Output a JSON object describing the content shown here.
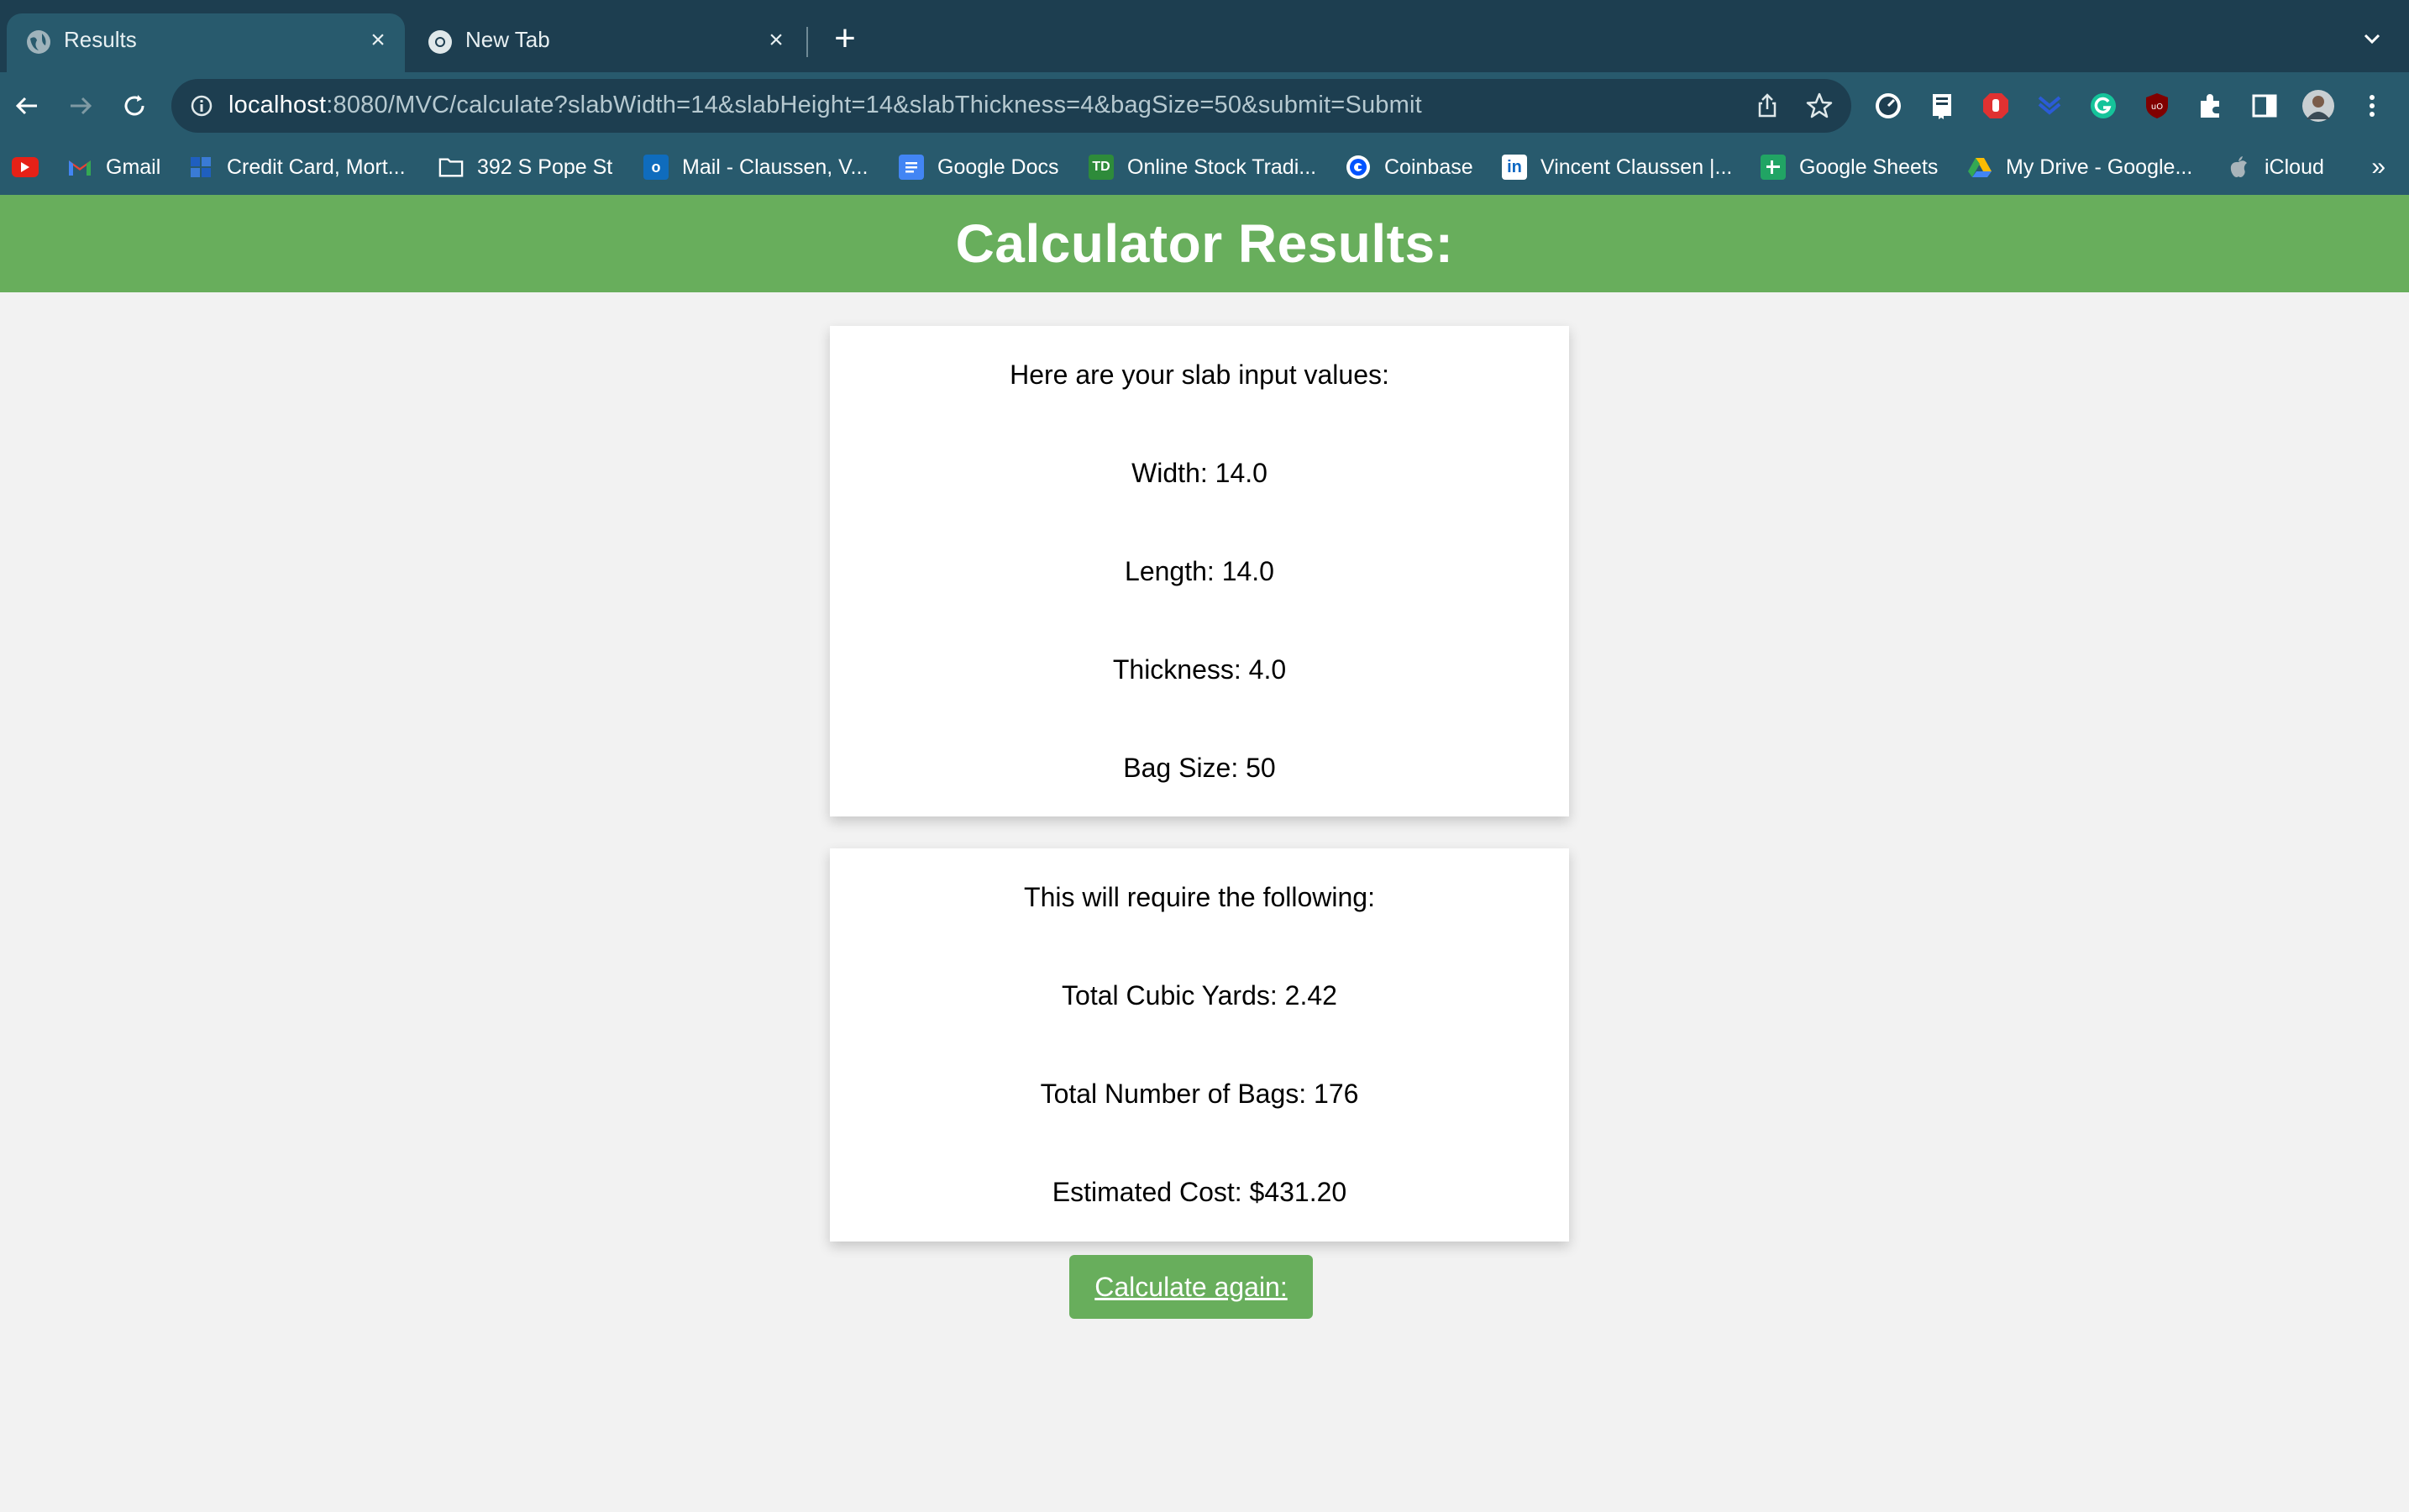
{
  "browser": {
    "tabs": [
      {
        "title": "Results",
        "active": true
      },
      {
        "title": "New Tab",
        "active": false
      }
    ],
    "url_host": "localhost",
    "url_rest": ":8080/MVC/calculate?slabWidth=14&slabHeight=14&slabThickness=4&bagSize=50&submit=Submit",
    "bookmarks": [
      {
        "label": "",
        "icon": "youtube-icon"
      },
      {
        "label": "Gmail",
        "icon": "gmail-icon"
      },
      {
        "label": "Credit Card, Mort...",
        "icon": "bank-icon"
      },
      {
        "label": "392 S Pope St",
        "icon": "folder-icon"
      },
      {
        "label": "Mail - Claussen, V...",
        "icon": "outlook-icon"
      },
      {
        "label": "Google Docs",
        "icon": "google-docs-icon"
      },
      {
        "label": "Online Stock Tradi...",
        "icon": "td-icon"
      },
      {
        "label": "Coinbase",
        "icon": "coinbase-icon"
      },
      {
        "label": "Vincent Claussen |...",
        "icon": "linkedin-icon"
      },
      {
        "label": "Google Sheets",
        "icon": "google-sheets-icon"
      },
      {
        "label": "My Drive - Google...",
        "icon": "google-drive-icon"
      },
      {
        "label": "iCloud",
        "icon": "apple-icon"
      }
    ],
    "bookmarks_overflow": "»"
  },
  "page": {
    "header": "Calculator Results:",
    "inputs": {
      "heading": "Here are your slab input values:",
      "width": "Width: 14.0",
      "length": "Length: 14.0",
      "thickness": "Thickness: 4.0",
      "bag_size": "Bag Size: 50"
    },
    "results": {
      "heading": "This will require the following:",
      "cubic_yards": "Total Cubic Yards: 2.42",
      "bags": "Total Number of Bags: 176",
      "cost": "Estimated Cost: $431.20"
    },
    "calculate_again": "Calculate again:"
  },
  "colors": {
    "accent_green": "#68ae5c",
    "chrome_dark": "#1d3e50",
    "chrome_light": "#285a6d",
    "page_bg": "#f2f2f2"
  }
}
